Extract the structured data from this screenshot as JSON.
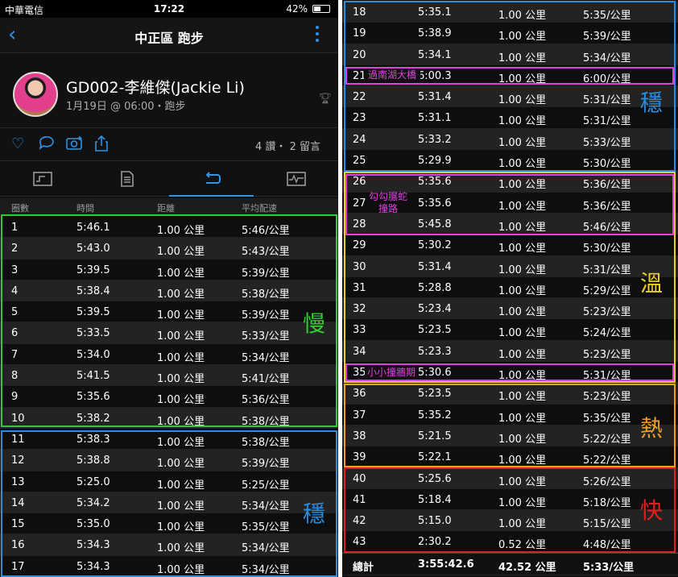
{
  "status_bar": {
    "carrier": "中華電信",
    "time": "17:22",
    "battery": "42%"
  },
  "nav": {
    "title": "中正區 跑步",
    "back_icon": "chevron-left-icon",
    "more_icon": "more-vertical-icon"
  },
  "profile": {
    "name": "GD002-李維傑(Jackie Li)",
    "meta": "1月19日 @ 06:00・跑步",
    "trophy_icon": "trophy-icon"
  },
  "social": {
    "counts": "4 讚・ 2 留言"
  },
  "columns": [
    "圈數",
    "時間",
    "距離",
    "平均配速"
  ],
  "laps": [
    [
      "1",
      "5:46.1",
      "1.00 公里",
      "5:46/公里"
    ],
    [
      "2",
      "5:43.0",
      "1.00 公里",
      "5:43/公里"
    ],
    [
      "3",
      "5:39.5",
      "1.00 公里",
      "5:39/公里"
    ],
    [
      "4",
      "5:38.4",
      "1.00 公里",
      "5:38/公里"
    ],
    [
      "5",
      "5:39.5",
      "1.00 公里",
      "5:39/公里"
    ],
    [
      "6",
      "5:33.5",
      "1.00 公里",
      "5:33/公里"
    ],
    [
      "7",
      "5:34.0",
      "1.00 公里",
      "5:34/公里"
    ],
    [
      "8",
      "5:41.5",
      "1.00 公里",
      "5:41/公里"
    ],
    [
      "9",
      "5:35.6",
      "1.00 公里",
      "5:36/公里"
    ],
    [
      "10",
      "5:38.2",
      "1.00 公里",
      "5:38/公里"
    ],
    [
      "11",
      "5:38.3",
      "1.00 公里",
      "5:38/公里"
    ],
    [
      "12",
      "5:38.8",
      "1.00 公里",
      "5:39/公里"
    ],
    [
      "13",
      "5:25.0",
      "1.00 公里",
      "5:25/公里"
    ],
    [
      "14",
      "5:34.2",
      "1.00 公里",
      "5:34/公里"
    ],
    [
      "15",
      "5:35.0",
      "1.00 公里",
      "5:35/公里"
    ],
    [
      "16",
      "5:34.3",
      "1.00 公里",
      "5:34/公里"
    ],
    [
      "17",
      "5:34.3",
      "1.00 公里",
      "5:34/公里"
    ],
    [
      "18",
      "5:35.1",
      "1.00 公里",
      "5:35/公里"
    ],
    [
      "19",
      "5:38.9",
      "1.00 公里",
      "5:39/公里"
    ],
    [
      "20",
      "5:34.1",
      "1.00 公里",
      "5:34/公里"
    ],
    [
      "21",
      "6:00.3",
      "1.00 公里",
      "6:00/公里"
    ],
    [
      "22",
      "5:31.4",
      "1.00 公里",
      "5:31/公里"
    ],
    [
      "23",
      "5:31.1",
      "1.00 公里",
      "5:31/公里"
    ],
    [
      "24",
      "5:33.2",
      "1.00 公里",
      "5:33/公里"
    ],
    [
      "25",
      "5:29.9",
      "1.00 公里",
      "5:30/公里"
    ],
    [
      "26",
      "5:35.6",
      "1.00 公里",
      "5:36/公里"
    ],
    [
      "27",
      "5:35.6",
      "1.00 公里",
      "5:36/公里"
    ],
    [
      "28",
      "5:45.8",
      "1.00 公里",
      "5:46/公里"
    ],
    [
      "29",
      "5:30.2",
      "1.00 公里",
      "5:30/公里"
    ],
    [
      "30",
      "5:31.4",
      "1.00 公里",
      "5:31/公里"
    ],
    [
      "31",
      "5:28.8",
      "1.00 公里",
      "5:29/公里"
    ],
    [
      "32",
      "5:23.4",
      "1.00 公里",
      "5:23/公里"
    ],
    [
      "33",
      "5:23.5",
      "1.00 公里",
      "5:24/公里"
    ],
    [
      "34",
      "5:23.3",
      "1.00 公里",
      "5:23/公里"
    ],
    [
      "35",
      "5:30.6",
      "1.00 公里",
      "5:31/公里"
    ],
    [
      "36",
      "5:23.5",
      "1.00 公里",
      "5:23/公里"
    ],
    [
      "37",
      "5:35.2",
      "1.00 公里",
      "5:35/公里"
    ],
    [
      "38",
      "5:21.5",
      "1.00 公里",
      "5:22/公里"
    ],
    [
      "39",
      "5:22.1",
      "1.00 公里",
      "5:22/公里"
    ],
    [
      "40",
      "5:25.6",
      "1.00 公里",
      "5:26/公里"
    ],
    [
      "41",
      "5:18.4",
      "1.00 公里",
      "5:18/公里"
    ],
    [
      "42",
      "5:15.0",
      "1.00 公里",
      "5:15/公里"
    ],
    [
      "43",
      "2:30.2",
      "0.52 公里",
      "4:48/公里"
    ]
  ],
  "total": [
    "總計",
    "3:55:42.6",
    "42.52 公里",
    "5:33/公里"
  ],
  "annotations": {
    "slow": "慢",
    "steady": "穩",
    "warm": "溫",
    "hot": "熱",
    "fast": "快",
    "note_21": "過南湖大橋",
    "note_26_28": "勾勾𦟌蛇撞路",
    "note_35": "小小撞牆期"
  },
  "colors": {
    "accent": "#2f93e6",
    "slow": "#2ecc2e",
    "steady": "#2a8de0",
    "warm": "#e8d21a",
    "hot": "#f0a020",
    "fast": "#e02020",
    "note": "#e040e0"
  }
}
